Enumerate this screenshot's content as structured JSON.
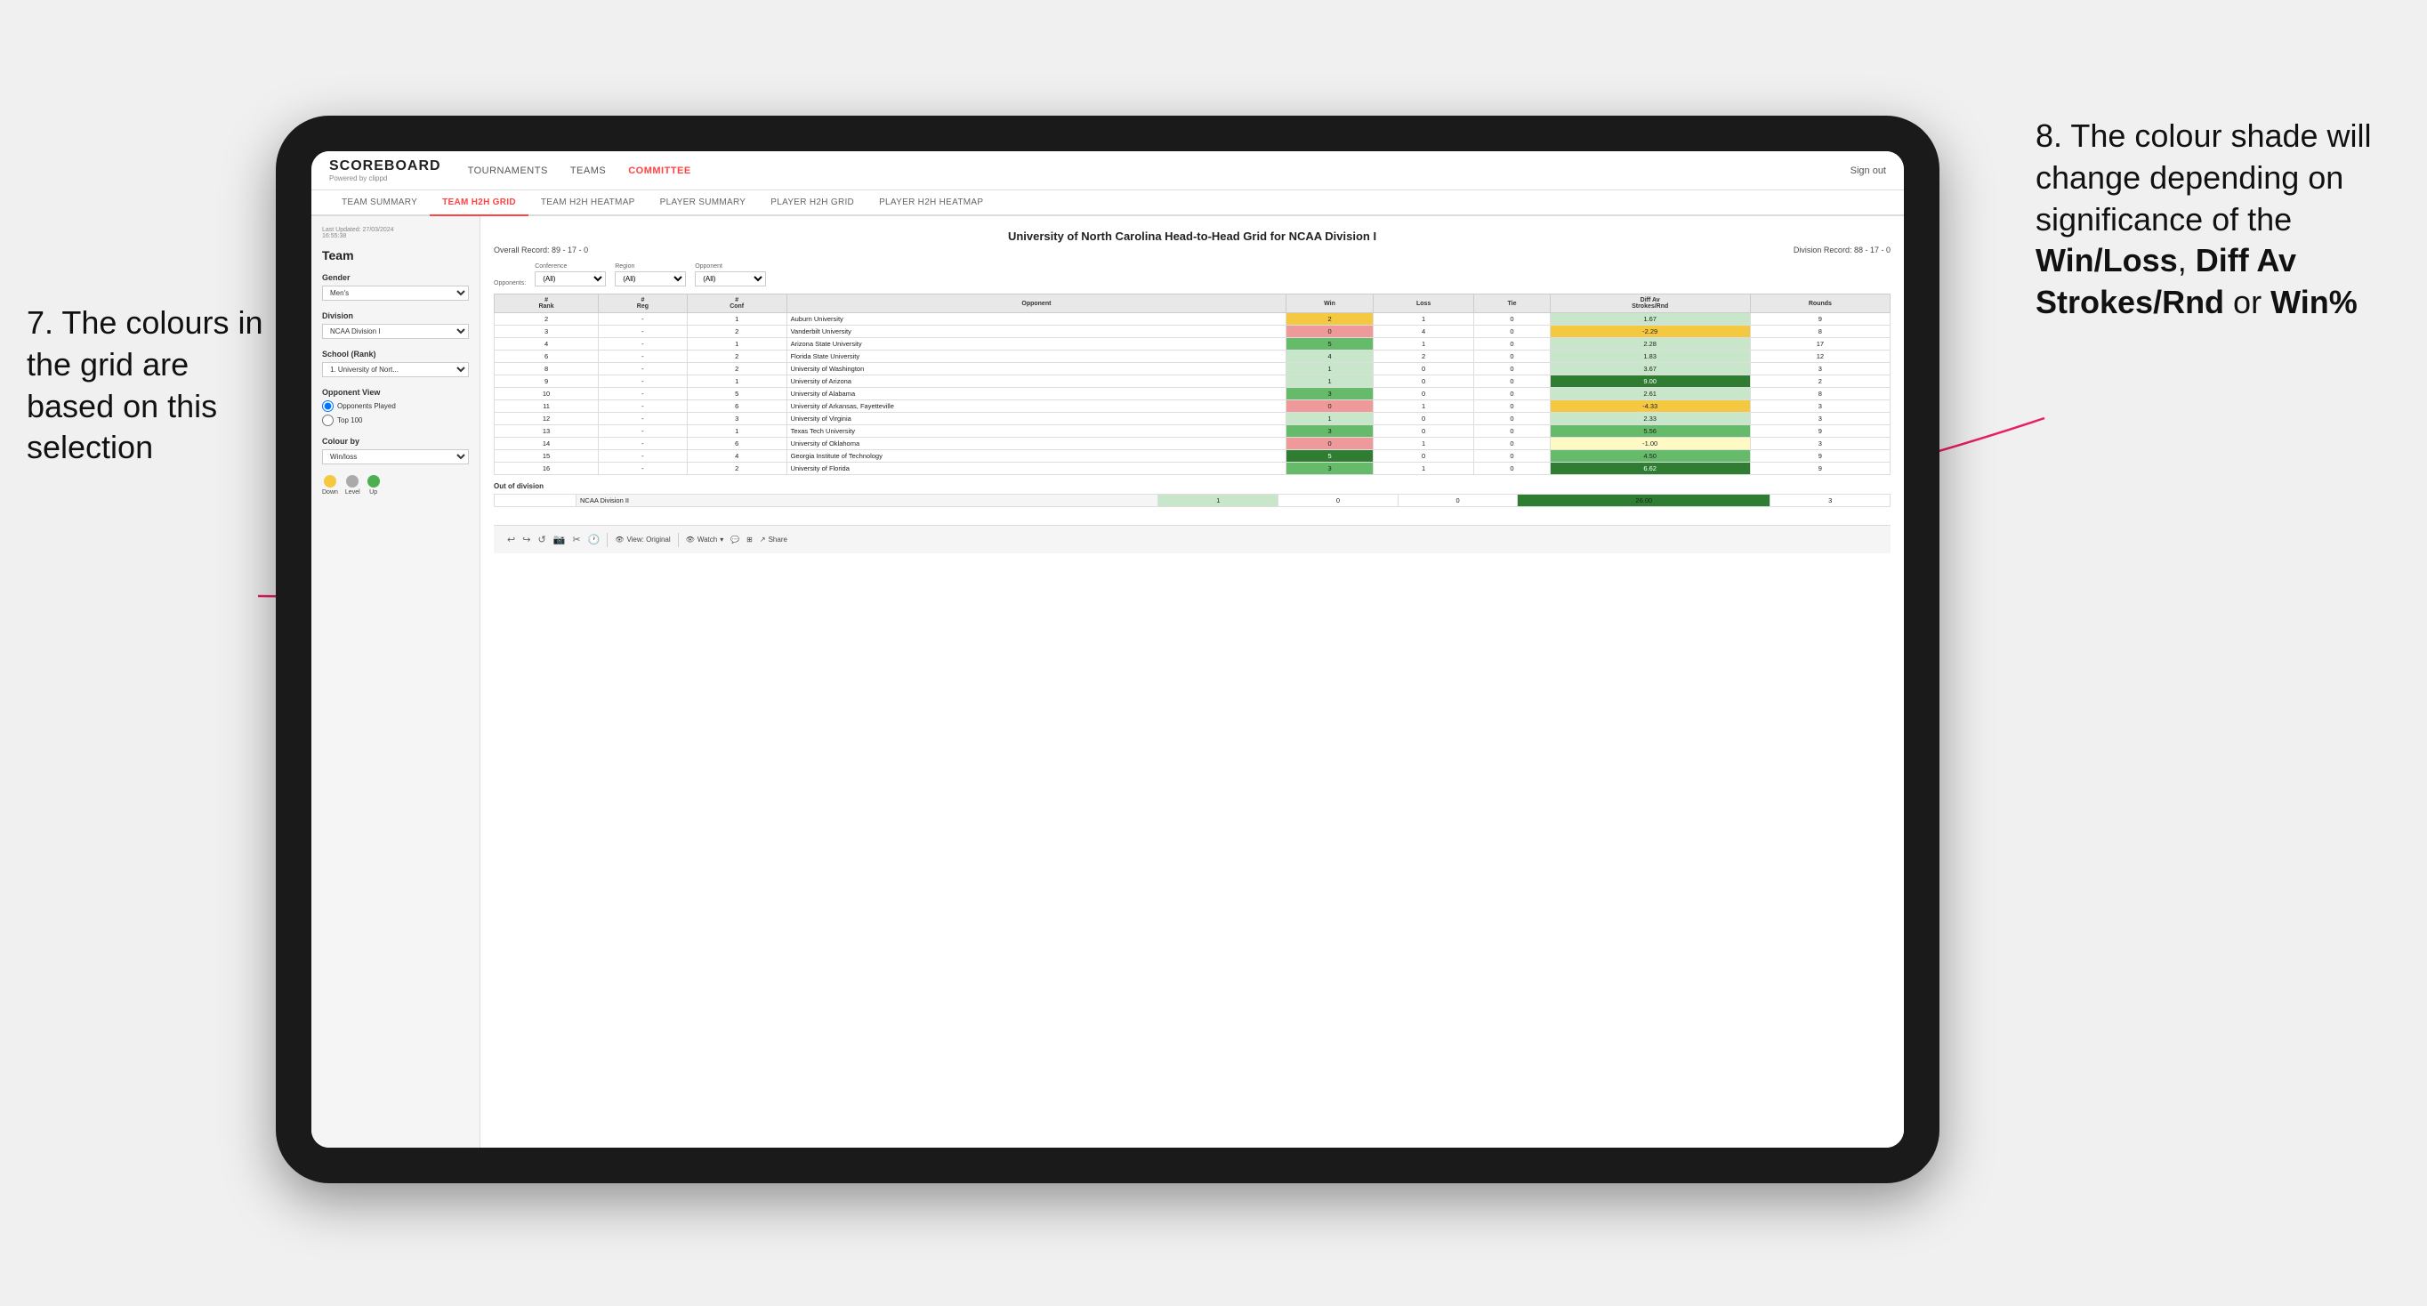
{
  "annotations": {
    "left_title": "7. The colours in the grid are based on this selection",
    "right_title": "8. The colour shade will change depending on significance of the",
    "right_bold1": "Win/Loss",
    "right_bold2": "Diff Av Strokes/Rnd",
    "right_bold3": "Win%"
  },
  "header": {
    "logo": "SCOREBOARD",
    "logo_sub": "Powered by clippd",
    "nav": [
      "TOURNAMENTS",
      "TEAMS",
      "COMMITTEE"
    ],
    "sign_out": "Sign out"
  },
  "sub_nav": {
    "items": [
      "TEAM SUMMARY",
      "TEAM H2H GRID",
      "TEAM H2H HEATMAP",
      "PLAYER SUMMARY",
      "PLAYER H2H GRID",
      "PLAYER H2H HEATMAP"
    ],
    "active": "TEAM H2H GRID"
  },
  "sidebar": {
    "last_updated_label": "Last Updated: 27/03/2024",
    "last_updated_time": "16:55:38",
    "team_label": "Team",
    "gender_label": "Gender",
    "gender_value": "Men's",
    "division_label": "Division",
    "division_value": "NCAA Division I",
    "school_label": "School (Rank)",
    "school_value": "1. University of Nort...",
    "opponent_view_label": "Opponent View",
    "opponents_played": "Opponents Played",
    "top_100": "Top 100",
    "colour_by_label": "Colour by",
    "colour_by_value": "Win/loss",
    "legend": {
      "down": "Down",
      "level": "Level",
      "up": "Up"
    }
  },
  "grid": {
    "title": "University of North Carolina Head-to-Head Grid for NCAA Division I",
    "overall_record_label": "Overall Record:",
    "overall_record": "89 - 17 - 0",
    "division_record_label": "Division Record:",
    "division_record": "88 - 17 - 0",
    "filters": {
      "opponents_label": "Opponents:",
      "conference_label": "Conference",
      "conference_value": "(All)",
      "region_label": "Region",
      "region_value": "(All)",
      "opponent_label": "Opponent",
      "opponent_value": "(All)"
    },
    "columns": [
      "#\nRank",
      "#\nReg",
      "#\nConf",
      "Opponent",
      "Win",
      "Loss",
      "Tie",
      "Diff Av\nStrokes/Rnd",
      "Rounds"
    ],
    "rows": [
      {
        "rank": "2",
        "reg": "-",
        "conf": "1",
        "opponent": "Auburn University",
        "win": "2",
        "loss": "1",
        "tie": "0",
        "diff": "1.67",
        "rounds": "9",
        "win_color": "yellow",
        "diff_color": "green-light"
      },
      {
        "rank": "3",
        "reg": "-",
        "conf": "2",
        "opponent": "Vanderbilt University",
        "win": "0",
        "loss": "4",
        "tie": "0",
        "diff": "-2.29",
        "rounds": "8",
        "win_color": "red",
        "diff_color": "yellow"
      },
      {
        "rank": "4",
        "reg": "-",
        "conf": "1",
        "opponent": "Arizona State University",
        "win": "5",
        "loss": "1",
        "tie": "0",
        "diff": "2.28",
        "rounds": "17",
        "win_color": "green",
        "diff_color": "green-light"
      },
      {
        "rank": "6",
        "reg": "-",
        "conf": "2",
        "opponent": "Florida State University",
        "win": "4",
        "loss": "2",
        "tie": "0",
        "diff": "1.83",
        "rounds": "12",
        "win_color": "green-light",
        "diff_color": "green-light"
      },
      {
        "rank": "8",
        "reg": "-",
        "conf": "2",
        "opponent": "University of Washington",
        "win": "1",
        "loss": "0",
        "tie": "0",
        "diff": "3.67",
        "rounds": "3",
        "win_color": "green-light",
        "diff_color": "green-light"
      },
      {
        "rank": "9",
        "reg": "-",
        "conf": "1",
        "opponent": "University of Arizona",
        "win": "1",
        "loss": "0",
        "tie": "0",
        "diff": "9.00",
        "rounds": "2",
        "win_color": "green-light",
        "diff_color": "green-dark"
      },
      {
        "rank": "10",
        "reg": "-",
        "conf": "5",
        "opponent": "University of Alabama",
        "win": "3",
        "loss": "0",
        "tie": "0",
        "diff": "2.61",
        "rounds": "8",
        "win_color": "green",
        "diff_color": "green-light"
      },
      {
        "rank": "11",
        "reg": "-",
        "conf": "6",
        "opponent": "University of Arkansas, Fayetteville",
        "win": "0",
        "loss": "1",
        "tie": "0",
        "diff": "-4.33",
        "rounds": "3",
        "win_color": "red",
        "diff_color": "yellow"
      },
      {
        "rank": "12",
        "reg": "-",
        "conf": "3",
        "opponent": "University of Virginia",
        "win": "1",
        "loss": "0",
        "tie": "0",
        "diff": "2.33",
        "rounds": "3",
        "win_color": "green-light",
        "diff_color": "green-light"
      },
      {
        "rank": "13",
        "reg": "-",
        "conf": "1",
        "opponent": "Texas Tech University",
        "win": "3",
        "loss": "0",
        "tie": "0",
        "diff": "5.56",
        "rounds": "9",
        "win_color": "green",
        "diff_color": "green"
      },
      {
        "rank": "14",
        "reg": "-",
        "conf": "6",
        "opponent": "University of Oklahoma",
        "win": "0",
        "loss": "1",
        "tie": "0",
        "diff": "-1.00",
        "rounds": "3",
        "win_color": "red",
        "diff_color": "yellow-light"
      },
      {
        "rank": "15",
        "reg": "-",
        "conf": "4",
        "opponent": "Georgia Institute of Technology",
        "win": "5",
        "loss": "0",
        "tie": "0",
        "diff": "4.50",
        "rounds": "9",
        "win_color": "green-dark",
        "diff_color": "green"
      },
      {
        "rank": "16",
        "reg": "-",
        "conf": "2",
        "opponent": "University of Florida",
        "win": "3",
        "loss": "1",
        "tie": "0",
        "diff": "6.62",
        "rounds": "9",
        "win_color": "green",
        "diff_color": "green-dark"
      }
    ],
    "out_of_division_label": "Out of division",
    "out_of_division_row": {
      "label": "NCAA Division II",
      "win": "1",
      "loss": "0",
      "tie": "0",
      "diff": "26.00",
      "rounds": "3",
      "diff_color": "green-dark"
    }
  },
  "toolbar": {
    "view_label": "View: Original",
    "watch_label": "Watch",
    "share_label": "Share"
  }
}
